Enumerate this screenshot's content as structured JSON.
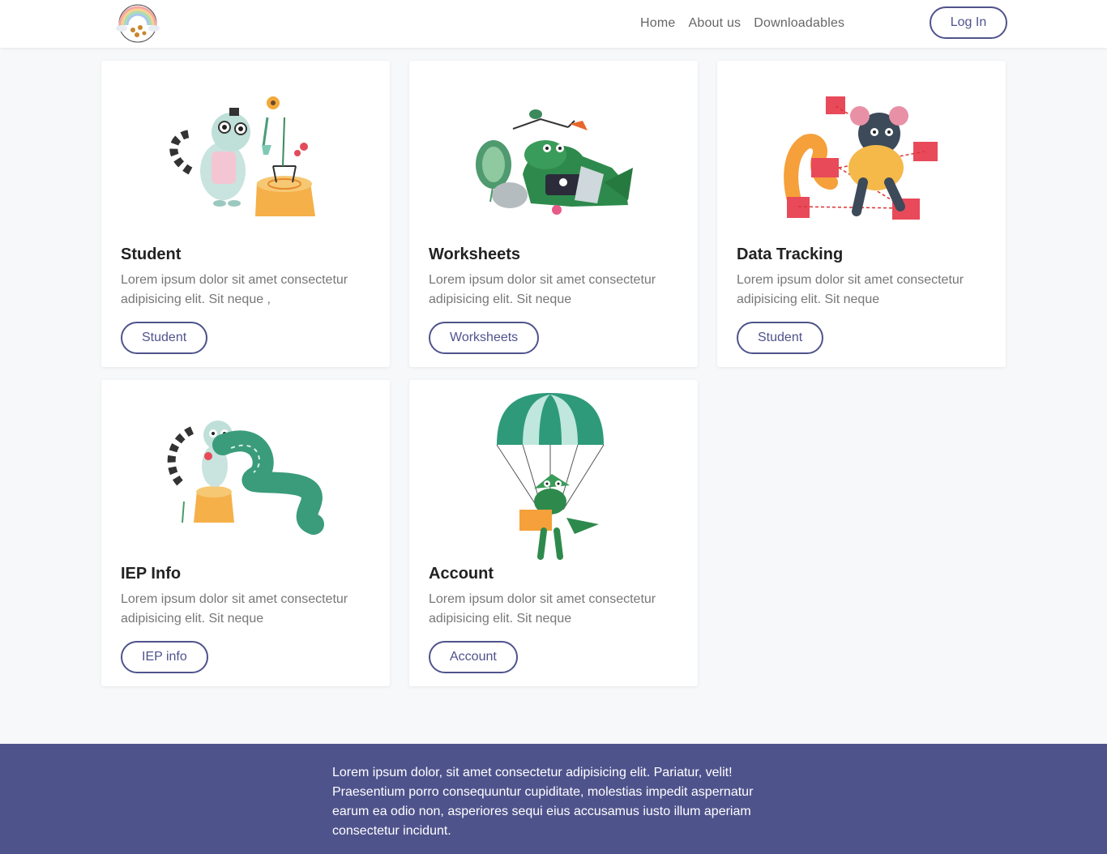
{
  "brand": {
    "logo_icon": "rainbow-bees-logo-icon"
  },
  "nav": {
    "links": [
      "Home",
      "About us",
      "Downloadables"
    ],
    "login_label": "Log In"
  },
  "cards": [
    {
      "title": "Student",
      "desc": "Lorem ipsum dolor sit amet consectetur adipisicing elit. Sit neque ,",
      "button": "Student",
      "icon": "lemur-scientist-illustration"
    },
    {
      "title": "Worksheets",
      "desc": "Lorem ipsum dolor sit amet consectetur adipisicing elit. Sit neque",
      "button": "Worksheets",
      "icon": "crocodile-laptop-illustration"
    },
    {
      "title": "Data Tracking",
      "desc": "Lorem ipsum dolor sit amet consectetur adipisicing elit. Sit neque",
      "button": "Student",
      "icon": "mouse-cubes-illustration"
    },
    {
      "title": "IEP Info",
      "desc": "Lorem ipsum dolor sit amet consectetur adipisicing elit. Sit neque",
      "button": "IEP info",
      "icon": "lemur-ribbon-illustration"
    },
    {
      "title": "Account",
      "desc": "Lorem ipsum dolor sit amet consectetur adipisicing elit. Sit neque",
      "button": "Account",
      "icon": "crocodile-parachute-illustration"
    }
  ],
  "footer": {
    "text": "Lorem ipsum dolor, sit amet consectetur adipisicing elit. Pariatur, velit! Praesentium porro consequuntur cupiditate, molestias impedit aspernatur earum ea odio non, asperiores sequi eius accusamus iusto illum aperiam consectetur incidunt."
  },
  "colors": {
    "accent": "#4f538c",
    "background": "#f7f8fa",
    "card": "#ffffff"
  }
}
